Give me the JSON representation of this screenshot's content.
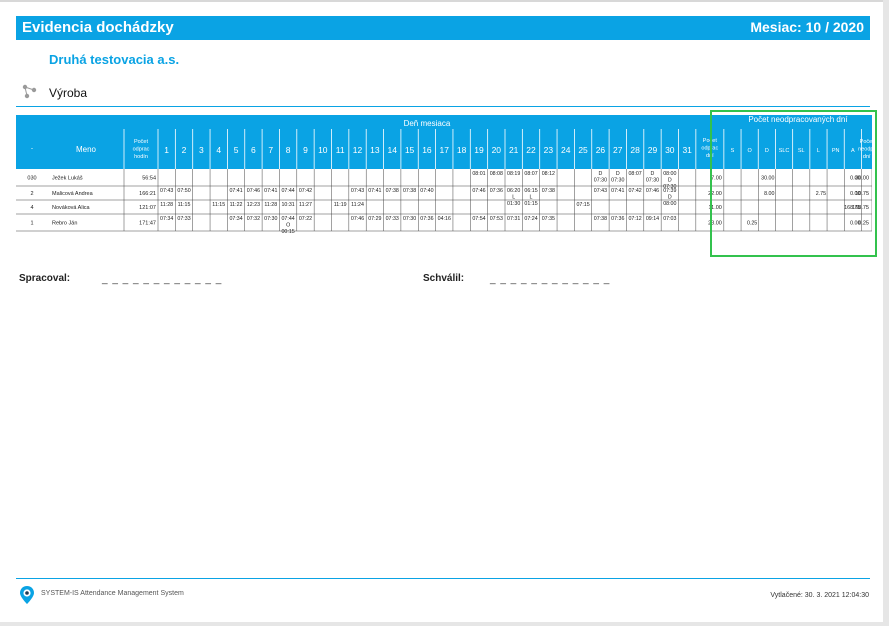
{
  "header": {
    "title": "Evidencia dochádzky",
    "month_label": "Mesiac: 10 / 2020"
  },
  "company": "Druhá testovacia a.s.",
  "department": {
    "icon": "org-structure-icon",
    "name": "Výroba"
  },
  "table": {
    "group_day_header": "Deň mesiaca",
    "group_missed_header": "Počet neodpracovaných dní",
    "col_dot": "·",
    "col_name": "Meno",
    "col_hours": "Počet odprac hodín",
    "days": [
      "1",
      "2",
      "3",
      "4",
      "5",
      "6",
      "7",
      "8",
      "9",
      "10",
      "11",
      "12",
      "13",
      "14",
      "15",
      "16",
      "17",
      "18",
      "19",
      "20",
      "21",
      "22",
      "23",
      "24",
      "25",
      "26",
      "27",
      "28",
      "29",
      "30",
      "31"
    ],
    "col_days_worked": "Počet odprac dní",
    "missed_codes": [
      "S",
      "O",
      "D",
      "SLC",
      "SL",
      "L",
      "PN",
      "A"
    ],
    "col_missed_total": "Počet neodpr dní",
    "rows": [
      {
        "id": "030",
        "name": "Ježek Lukáš",
        "hours": "56:54",
        "cells": {
          "19": "08:01",
          "20": "08:08",
          "21": "08:19",
          "22": "08:07",
          "23": "08:12",
          "26": "D|07:30",
          "27": "D|07:30",
          "28": "08:07",
          "29": "D|07:30",
          "30": "08:00|D|07:30"
        },
        "days_worked": "7.00",
        "missed": [
          "",
          "",
          "30.00",
          "",
          "",
          "",
          "",
          "0.00"
        ],
        "missed_total": "30.00"
      },
      {
        "id": "2",
        "name": "Malicová Andrea",
        "hours": "166:21",
        "cells": {
          "1": "07:43",
          "2": "07:50",
          "5": "07:41",
          "6": "07:46",
          "7": "07:41",
          "8": "07:44",
          "9": "07:42",
          "12": "07:43",
          "13": "07:41",
          "14": "07:38",
          "15": "07:38",
          "16": "07:40",
          "19": "07:46",
          "20": "07:36",
          "21": "06:20|L|01:30",
          "22": "06:15|L|01:15",
          "23": "07:38",
          "26": "07:43",
          "27": "07:41",
          "28": "07:42",
          "29": "07:46",
          "30": "07:39|D|08:00"
        },
        "days_worked": "22.00",
        "missed": [
          "",
          "",
          "8.00",
          "",
          "",
          "2.75",
          "",
          "0.00"
        ],
        "missed_total": "10.75"
      },
      {
        "id": "4",
        "name": "Nováková Alica",
        "hours": "121:07",
        "cells": {
          "1": "11:28",
          "2": "11:15",
          "4": "11:15",
          "5": "11:22",
          "6": "12:23",
          "7": "11:28",
          "8": "10:31",
          "9": "11:27",
          "11": "11:19",
          "12": "11:24",
          "25": "07:15"
        },
        "days_worked": "11.00",
        "missed": [
          "",
          "",
          "",
          "",
          "",
          "",
          "",
          "168.75"
        ],
        "missed_total": "168.75"
      },
      {
        "id": "1",
        "name": "Rebro Ján",
        "hours": "171:47",
        "cells": {
          "1": "07:34",
          "2": "07:33",
          "5": "07:34",
          "6": "07:32",
          "7": "07:30",
          "8": "07:44|O|00:15",
          "9": "07:22",
          "12": "07:46",
          "13": "07:29",
          "14": "07:33",
          "15": "07:30",
          "16": "07:36",
          "17": "04:16",
          "19": "07:54",
          "20": "07:53",
          "21": "07:31",
          "22": "07:24",
          "23": "07:35",
          "26": "07:38",
          "27": "07:36",
          "28": "07:12",
          "29": "09:14",
          "30": "07:03"
        },
        "days_worked": "23.00",
        "missed": [
          "",
          "0.25",
          "",
          "",
          "",
          "",
          "",
          "0.00"
        ],
        "missed_total": "0.25"
      }
    ]
  },
  "signatures": {
    "processed_label": "Spracoval:",
    "approved_label": "Schválil:",
    "line": "_ _ _ _ _ _ _ _ _ _ _ _"
  },
  "footer": {
    "logo_icon": "location-pin-eye-icon",
    "app_name": "SYSTEM-IS Attendance Management System",
    "printed": "Vytlačené: 30. 3. 2021 12:04:30"
  },
  "colors": {
    "brand_blue": "#0aa3e4",
    "highlight_green": "#33c24d"
  }
}
